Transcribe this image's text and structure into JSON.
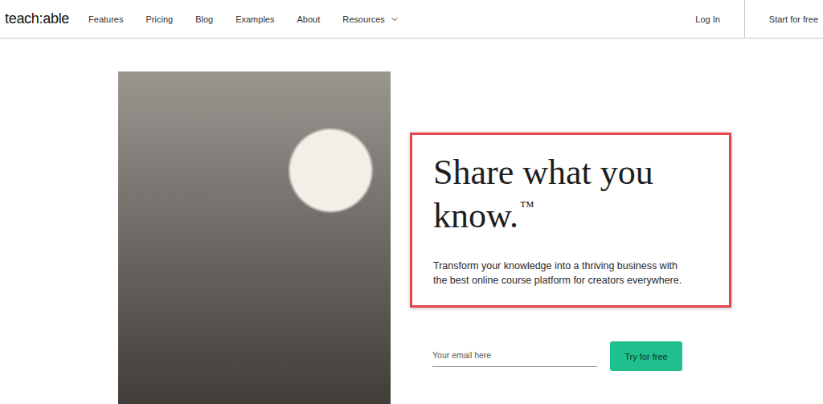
{
  "header": {
    "logo": "teach:able",
    "nav": [
      {
        "label": "Features",
        "has_dropdown": false
      },
      {
        "label": "Pricing",
        "has_dropdown": false
      },
      {
        "label": "Blog",
        "has_dropdown": false
      },
      {
        "label": "Examples",
        "has_dropdown": false
      },
      {
        "label": "About",
        "has_dropdown": false
      },
      {
        "label": "Resources",
        "has_dropdown": true
      }
    ],
    "login": "Log In",
    "cta": "Start for free"
  },
  "hero": {
    "headline_lines": [
      "Share what you",
      "know."
    ],
    "trademark": "™",
    "subtext": "Transform your knowledge into a thriving business with the best online course platform for creators everywhere.",
    "highlighted": true,
    "email_placeholder": "Your email here",
    "button": "Try for free"
  }
}
